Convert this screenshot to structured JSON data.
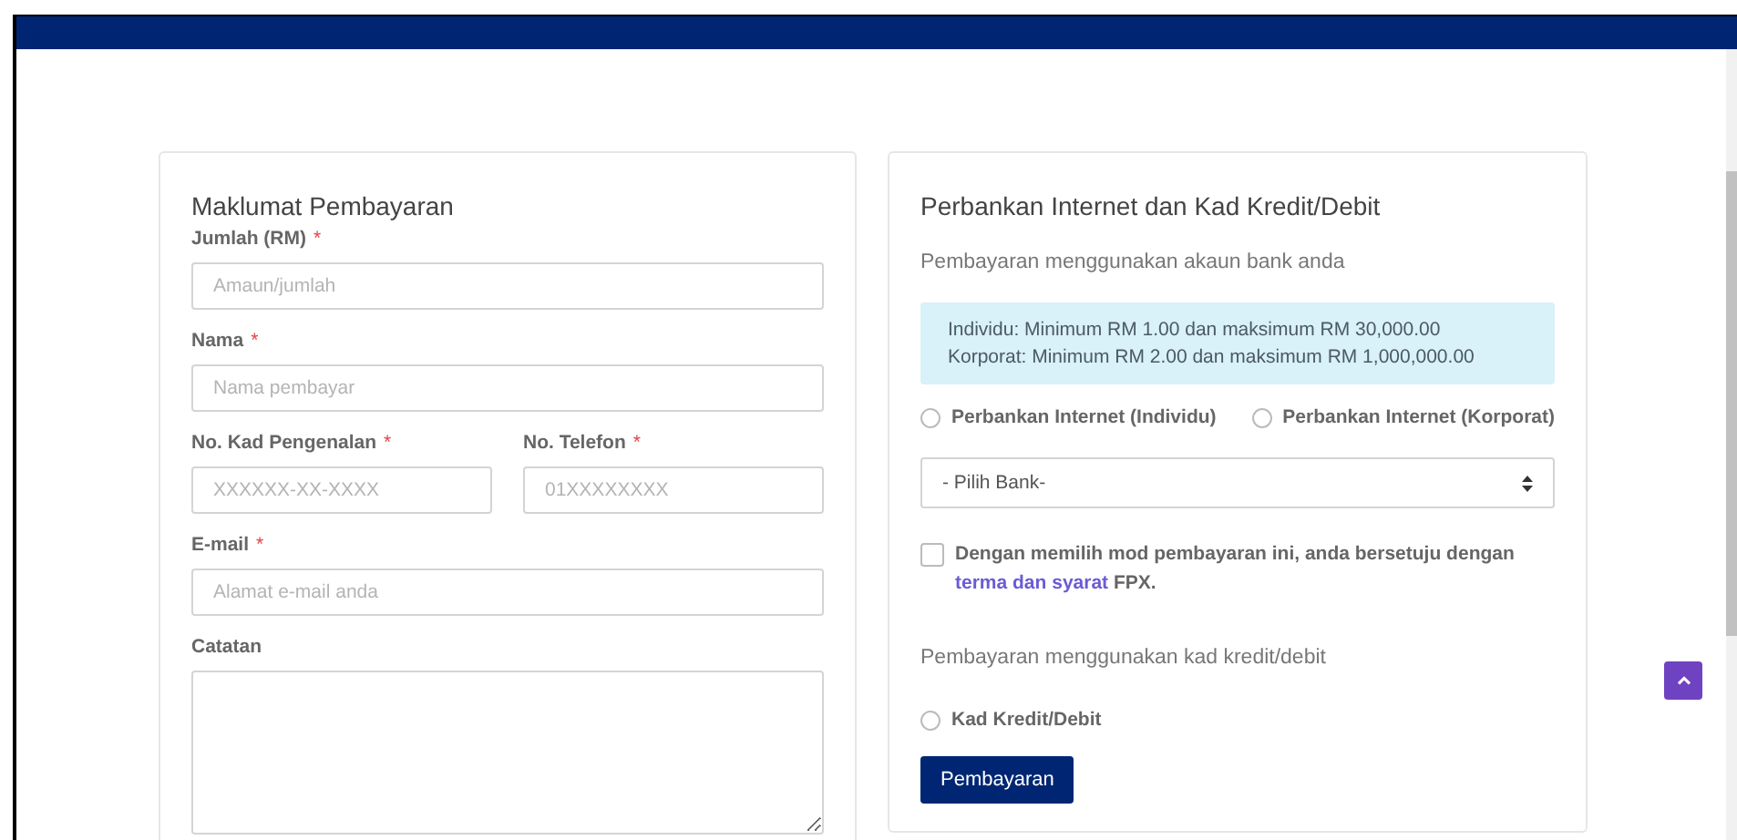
{
  "payment_details": {
    "title": "Maklumat Pembayaran",
    "rows": [
      [
        {
          "label": "Jumlah (RM)",
          "required_mark": "*",
          "placeholder": "Amaun/jumlah",
          "kind": "input"
        }
      ],
      [
        {
          "label": "Nama",
          "required_mark": "*",
          "placeholder": "Nama pembayar",
          "kind": "input"
        }
      ],
      [
        {
          "label": "No. Kad Pengenalan",
          "required_mark": "*",
          "placeholder": "XXXXXX-XX-XXXX",
          "kind": "input"
        },
        {
          "label": "No. Telefon",
          "required_mark": "*",
          "placeholder": "01XXXXXXXX",
          "kind": "input"
        }
      ],
      [
        {
          "label": "E-mail",
          "required_mark": "*",
          "placeholder": "Alamat e-mail anda",
          "kind": "input"
        }
      ],
      [
        {
          "label": "Catatan",
          "kind": "textarea"
        }
      ]
    ]
  },
  "payment_method": {
    "title": "Perbankan Internet dan Kad Kredit/Debit",
    "bank_subtitle": "Pembayaran menggunakan akaun bank anda",
    "limits": [
      "Individu: Minimum RM 1.00 dan maksimum RM 30,000.00",
      "Korporat: Minimum RM 2.00 dan maksimum RM 1,000,000.00"
    ],
    "bank_options": [
      {
        "label": "Perbankan Internet (Individu)",
        "selected": false
      },
      {
        "label": "Perbankan Internet (Korporat)",
        "selected": false
      }
    ],
    "bank_select": {
      "value": "- Pilih Bank-"
    },
    "agreement": {
      "checked": false,
      "before": "Dengan memilih mod pembayaran ini, anda bersetuju dengan",
      "link": "terma dan syarat",
      "after": "FPX."
    },
    "card_subtitle": "Pembayaran menggunakan kad kredit/debit",
    "card_options": [
      {
        "label": "Kad Kredit/Debit",
        "selected": false
      }
    ],
    "submit": "Pembayaran"
  }
}
